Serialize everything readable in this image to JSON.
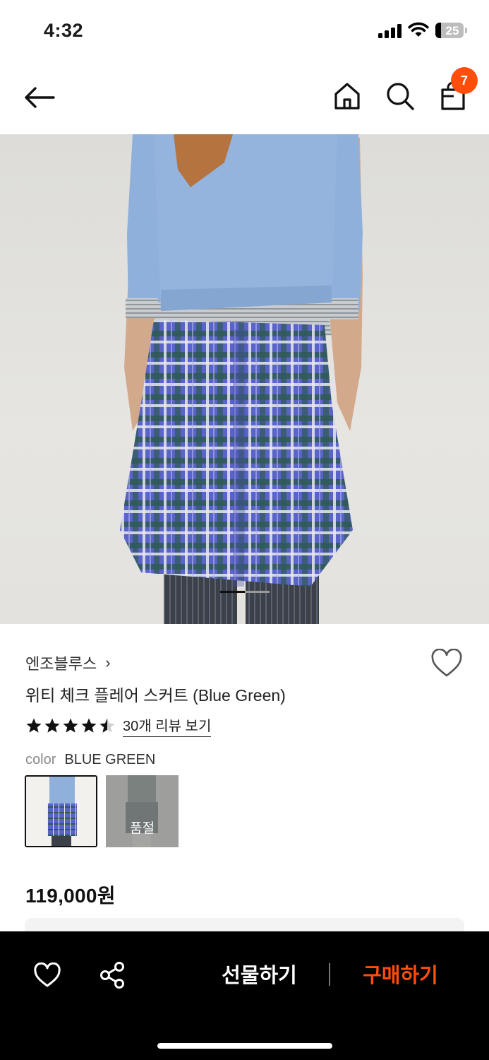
{
  "status_bar": {
    "time": "4:32",
    "battery_percent": "25",
    "icons": [
      "signal-icon",
      "wifi-icon",
      "battery-icon"
    ]
  },
  "nav": {
    "cart_count": "7",
    "icons": [
      "back-arrow-icon",
      "home-icon",
      "search-icon",
      "shopping-bag-icon"
    ],
    "badge_color": "#ff4d0a"
  },
  "product": {
    "brand": "엔조블루스",
    "brand_chevron": "›",
    "name": "위티 체크 플레어 스커트 (Blue Green)",
    "rating": 4.5,
    "rating_max": 5,
    "review_link": "30개 리뷰 보기",
    "color_label": "color",
    "color_value": "BLUE GREEN",
    "swatches": [
      {
        "selected": true,
        "sold_out": false
      },
      {
        "selected": false,
        "sold_out": true,
        "label": "품절"
      }
    ],
    "price": "119,000원",
    "image_page": 1,
    "image_total": 2
  },
  "bottom_bar": {
    "gift_label": "선물하기",
    "buy_label": "구매하기",
    "buy_color": "#ff4d0a",
    "icons": [
      "heart-icon",
      "share-icon"
    ]
  }
}
